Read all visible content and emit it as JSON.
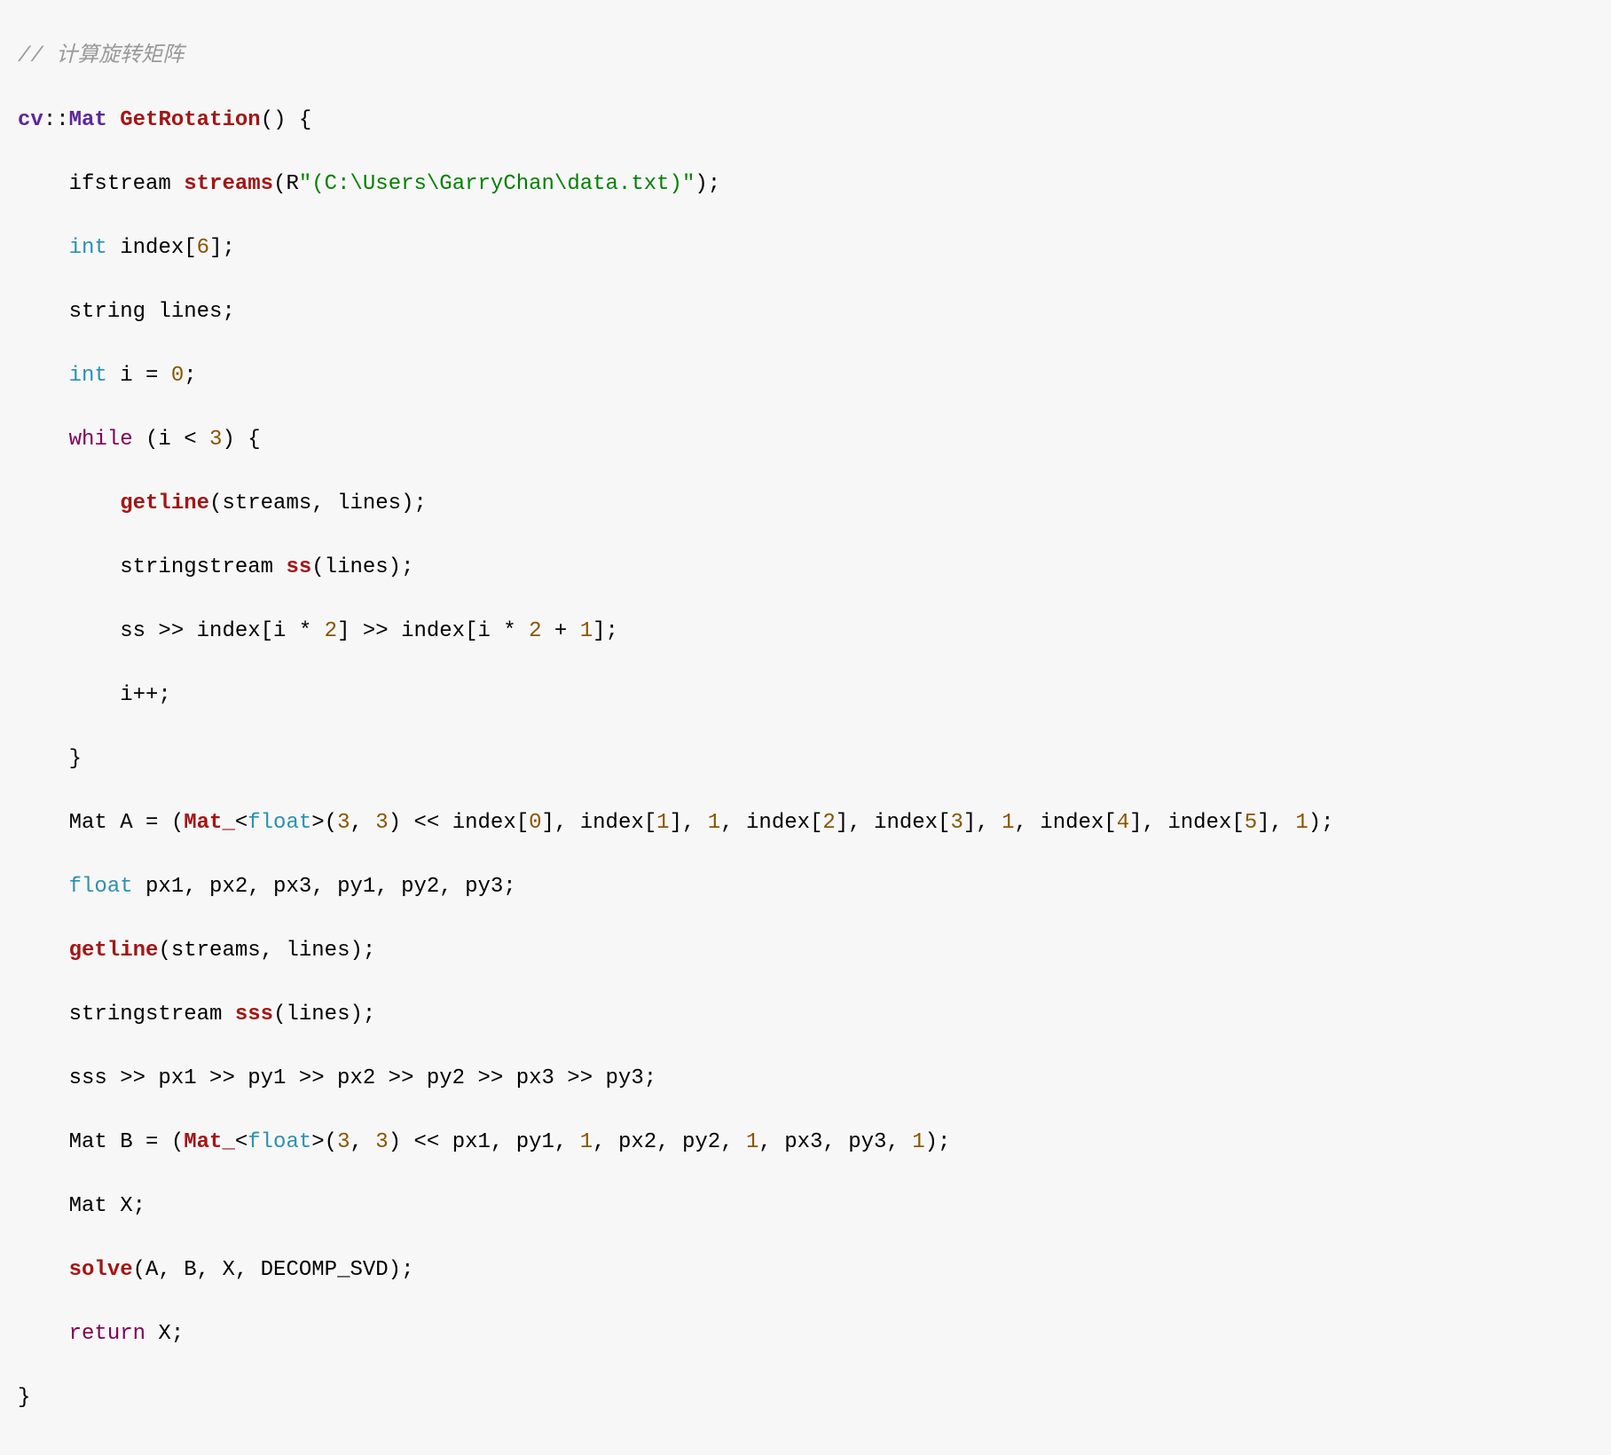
{
  "code": {
    "l01_comment": "// 计算旋转矩阵",
    "l02": {
      "ns": "cv",
      "sep": "::",
      "type": "Mat",
      "sp": " ",
      "fn": "GetRotation",
      "paren": "()",
      "brace": " {"
    },
    "l03": {
      "indent": "    ",
      "t1": "ifstream ",
      "fn": "streams",
      "p1": "(R",
      "str": "\"(C:\\Users\\GarryChan\\data.txt)\"",
      "p2": ");"
    },
    "l04": {
      "indent": "    ",
      "type": "int",
      "rest": " index[",
      "num": "6",
      "end": "];"
    },
    "l05": {
      "indent": "    ",
      "t": "string lines;"
    },
    "l06": {
      "indent": "    ",
      "type": "int",
      "mid": " i = ",
      "num": "0",
      "end": ";"
    },
    "l07": {
      "indent": "    ",
      "kw": "while",
      "mid": " (i < ",
      "num": "3",
      "end": ") {"
    },
    "l08": {
      "indent": "        ",
      "fn": "getline",
      "rest": "(streams, lines);"
    },
    "l09": {
      "indent": "        ",
      "t1": "stringstream ",
      "fn": "ss",
      "rest": "(lines);"
    },
    "l10": {
      "indent": "        ",
      "t1": "ss >> index[i * ",
      "n1": "2",
      "t2": "] >> index[i * ",
      "n2": "2",
      "t3": " + ",
      "n3": "1",
      "t4": "];"
    },
    "l11": {
      "indent": "        ",
      "t": "i++;"
    },
    "l12": {
      "indent": "    ",
      "t": "}"
    },
    "l13": {
      "indent": "    ",
      "t1": "Mat A = (",
      "cls": "Mat_",
      "t2": "<",
      "ft": "float",
      "t3": ">(",
      "n1": "3",
      "t4": ", ",
      "n2": "3",
      "t5": ") << index[",
      "n3": "0",
      "t6": "], index[",
      "n4": "1",
      "t7": "], ",
      "n5": "1",
      "t8": ", index[",
      "n6": "2",
      "t9": "], index[",
      "n7": "3",
      "t10": "], ",
      "n8": "1",
      "t11": ", index[",
      "n9": "4",
      "t12": "], index[",
      "n10": "5",
      "t13": "], ",
      "n11": "1",
      "t14": ");"
    },
    "l14": {
      "indent": "    ",
      "ft": "float",
      "rest": " px1, px2, px3, py1, py2, py3;"
    },
    "l15": {
      "indent": "    ",
      "fn": "getline",
      "rest": "(streams, lines);"
    },
    "l16": {
      "indent": "    ",
      "t1": "stringstream ",
      "fn": "sss",
      "rest": "(lines);"
    },
    "l17": {
      "indent": "    ",
      "t": "sss >> px1 >> py1 >> px2 >> py2 >> px3 >> py3;"
    },
    "l18": {
      "indent": "    ",
      "t1": "Mat B = (",
      "cls": "Mat_",
      "t2": "<",
      "ft": "float",
      "t3": ">(",
      "n1": "3",
      "t4": ", ",
      "n2": "3",
      "t5": ") << px1, py1, ",
      "n3": "1",
      "t6": ", px2, py2, ",
      "n4": "1",
      "t7": ", px3, py3, ",
      "n5": "1",
      "t8": ");"
    },
    "l19": {
      "indent": "    ",
      "t": "Mat X;"
    },
    "l20": {
      "indent": "    ",
      "fn": "solve",
      "rest": "(A, B, X, DECOMP_SVD);"
    },
    "l21": {
      "indent": "    ",
      "kw": "return",
      "rest": " X;"
    },
    "l22": {
      "t": "}"
    }
  }
}
